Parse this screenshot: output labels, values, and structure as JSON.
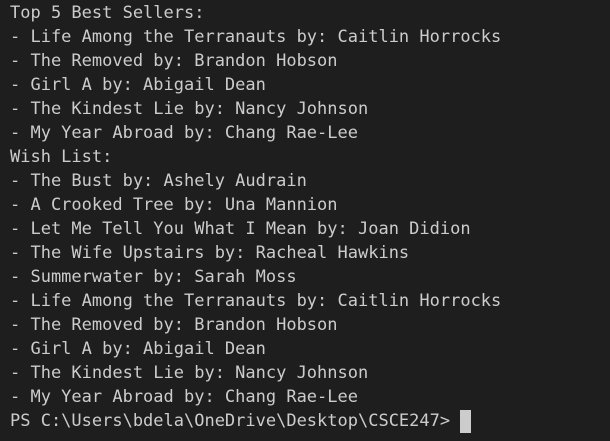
{
  "terminal": {
    "colors": {
      "background": "#1e1e1e",
      "text": "#cccccc",
      "cursor": "#cccccc"
    },
    "best_sellers_header": "Top 5 Best Sellers:",
    "best_sellers": [
      "- Life Among the Terranauts by: Caitlin Horrocks",
      "- The Removed by: Brandon Hobson",
      "- Girl A by: Abigail Dean",
      "- The Kindest Lie by: Nancy Johnson",
      "- My Year Abroad by: Chang Rae-Lee"
    ],
    "wish_list_header": "Wish List:",
    "wish_list": [
      "- The Bust by: Ashely Audrain",
      "- A Crooked Tree by: Una Mannion",
      "- Let Me Tell You What I Mean by: Joan Didion",
      "- The Wife Upstairs by: Racheal Hawkins",
      "- Summerwater by: Sarah Moss",
      "- Life Among the Terranauts by: Caitlin Horrocks",
      "- The Removed by: Brandon Hobson",
      "- Girl A by: Abigail Dean",
      "- The Kindest Lie by: Nancy Johnson",
      "- My Year Abroad by: Chang Rae-Lee"
    ],
    "prompt": "PS C:\\Users\\bdela\\OneDrive\\Desktop\\CSCE247>"
  }
}
